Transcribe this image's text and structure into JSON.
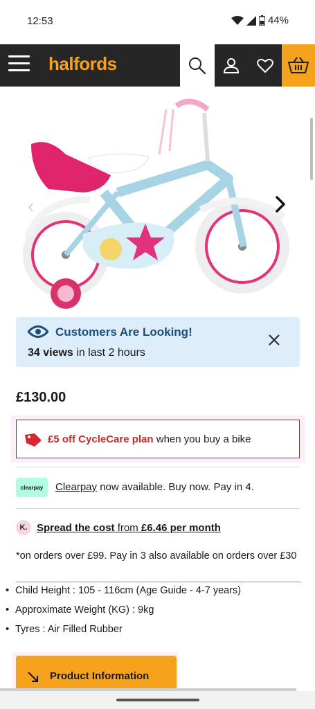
{
  "status": {
    "time": "12:53",
    "battery": "44%"
  },
  "header": {
    "logo": "halfords",
    "icons": [
      "menu-icon",
      "search-icon",
      "user-icon",
      "heart-icon",
      "basket-icon"
    ]
  },
  "colors": {
    "brand_orange": "#f7a21c",
    "header_dark": "#262626",
    "info_blue_bg": "#ddeefa",
    "info_blue_text": "#1c4d7a",
    "promo_red": "#c52a2a",
    "clearpay_mint": "#b2fce4"
  },
  "looking": {
    "title": "Customers Are Looking!",
    "views_count": "34 views",
    "views_rest": " in last 2 hours"
  },
  "product": {
    "price": "£130.00"
  },
  "promo": {
    "highlight": "£5 off CycleCare plan",
    "rest": " when you buy a bike"
  },
  "clearpay": {
    "badge": "clearpay",
    "link": "Clearpay",
    "rest": " now available. Buy now. Pay in 4."
  },
  "klarna": {
    "badge": "K.",
    "spread": "Spread the cost",
    "from": " from ",
    "amount": "£6.46 per month"
  },
  "footnote": "*on orders over £99. Pay in 3 also available on orders over £30",
  "specs": [
    "Child Height : 105 - 116cm (Age Guide - 4-7 years)",
    "Approximate Weight (KG) : 9kg",
    "Tyres : Air Filled Rubber"
  ],
  "product_info_button": "Product Information"
}
